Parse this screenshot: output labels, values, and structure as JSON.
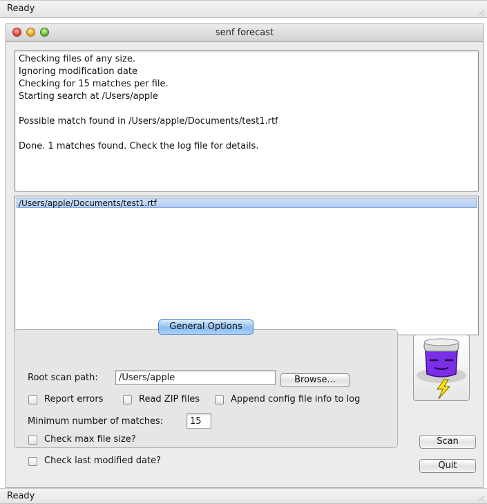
{
  "outer_status_top": "Ready",
  "outer_status_bottom": "Ready",
  "window": {
    "title": "senf forecast"
  },
  "log": {
    "lines": [
      "Checking files of any size.",
      "Ignoring modification date",
      "Checking for 15 matches per file.",
      "Starting search at /Users/apple",
      "",
      "Possible match found in /Users/apple/Documents/test1.rtf",
      "",
      "Done. 1 matches found. Check the log file for details."
    ]
  },
  "results": {
    "items": [
      "/Users/apple/Documents/test1.rtf"
    ]
  },
  "options": {
    "tab_label": "General Options",
    "root_scan_path_label": "Root scan path:",
    "root_scan_path_value": "/Users/apple",
    "browse_label": "Browse...",
    "report_errors_label": "Report errors",
    "report_errors_checked": false,
    "read_zip_label": "Read ZIP files",
    "read_zip_checked": false,
    "append_config_label": "Append config file info to log",
    "append_config_checked": false,
    "min_matches_label": "Minimum number of matches:",
    "min_matches_value": "15",
    "check_max_size_label": "Check max file size?",
    "check_max_size_checked": false,
    "check_last_modified_label": "Check last modified date?",
    "check_last_modified_checked": false
  },
  "actions": {
    "scan_label": "Scan",
    "quit_label": "Quit"
  },
  "colors": {
    "accent": "#8cbcf0",
    "selection": "#b3cdf1",
    "mascot": "#7a2ee8"
  },
  "icons": [
    "close-light-icon",
    "minimize-light-icon",
    "zoom-light-icon",
    "resize-grip-icon",
    "jar-lightning-icon"
  ]
}
